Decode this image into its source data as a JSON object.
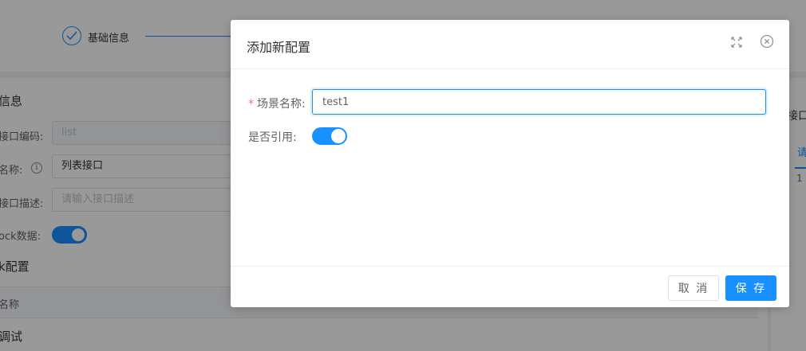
{
  "background": {
    "step": {
      "label": "基础信息"
    },
    "section_basic": "信息",
    "fields": [
      {
        "label": "接口编码:",
        "value": "list"
      },
      {
        "label": "名称:",
        "value": "列表接口"
      },
      {
        "label": "接口描述:",
        "placeholder": "请输入接口描述"
      },
      {
        "label": "ock数据:"
      }
    ],
    "section_mock": "k配置",
    "table_header": "名称",
    "section_debug": "调试",
    "right_panel": {
      "label": "接口",
      "tab": "请",
      "row_num": "1"
    }
  },
  "dialog": {
    "title": "添加新配置",
    "scene_name": {
      "label": "场景名称:",
      "required_mark": "*",
      "value": "test1"
    },
    "is_reference": {
      "label": "是否引用:",
      "checked": true
    },
    "buttons": {
      "cancel": "取 消",
      "save": "保 存"
    }
  },
  "colors": {
    "primary": "#1890ff",
    "required": "#f56c6c"
  }
}
